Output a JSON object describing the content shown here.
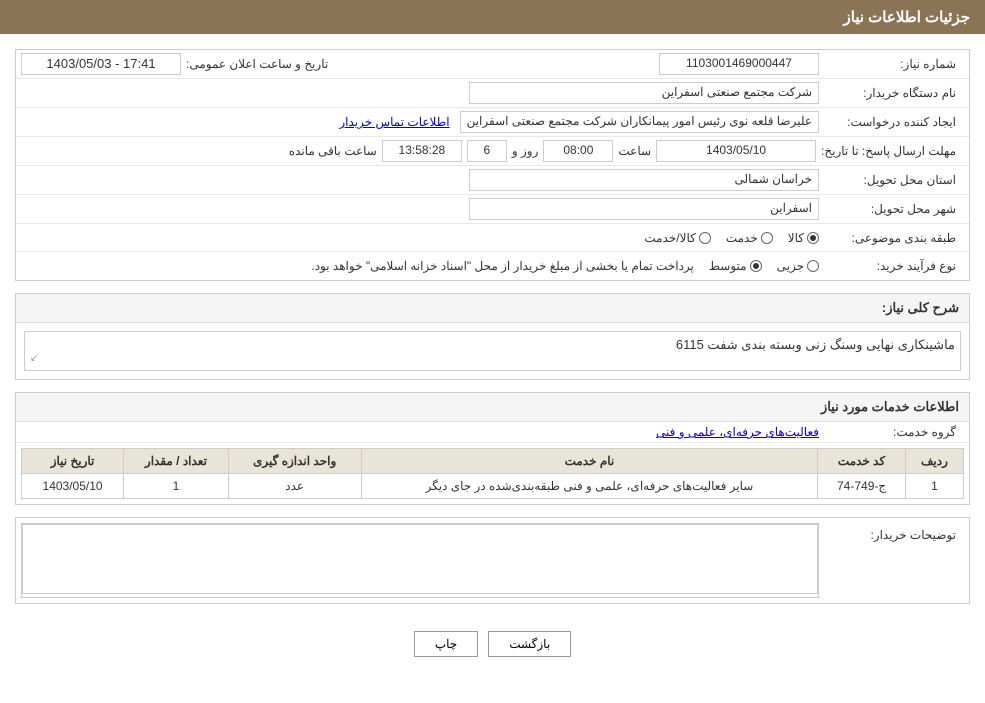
{
  "header": {
    "title": "جزئیات اطلاعات نیاز"
  },
  "fields": {
    "need_number_label": "شماره نیاز:",
    "need_number_value": "1103001469000447",
    "announce_date_label": "تاریخ و ساعت اعلان عمومی:",
    "announce_date_value": "1403/05/03 - 17:41",
    "buyer_name_label": "نام دستگاه خریدار:",
    "buyer_name_value": "شرکت مجتمع صنعتی اسفراین",
    "requester_label": "ایجاد کننده درخواست:",
    "requester_value": "علیرضا قلعه نوی رئیس امور پیمانکاران شرکت مجتمع صنعتی اسفراین",
    "contact_info_link": "اطلاعات تماس خریدار",
    "deadline_label": "مهلت ارسال پاسخ: تا تاریخ:",
    "deadline_date": "1403/05/10",
    "deadline_time_label": "ساعت",
    "deadline_time": "08:00",
    "deadline_day_label": "روز و",
    "deadline_days": "6",
    "deadline_remaining_label": "ساعت باقی مانده",
    "deadline_remaining": "13:58:28",
    "province_label": "استان محل تحویل:",
    "province_value": "خراسان شمالی",
    "city_label": "شهر محل تحویل:",
    "city_value": "اسفراین",
    "category_label": "طبقه بندی موضوعی:",
    "category_options": [
      "کالا",
      "خدمت",
      "کالا/خدمت"
    ],
    "category_selected": "کالا",
    "purchase_type_label": "نوع فرآیند خرید:",
    "purchase_options": [
      "جزیی",
      "متوسط"
    ],
    "purchase_warning": "پرداخت تمام یا بخشی از مبلغ خریدار از محل \"اسناد خزانه اسلامی\" خواهد بود.",
    "need_description_label": "شرح کلی نیاز:",
    "need_description_value": "ماشینکاری نهایی وسنگ زنی وبسته بندی شفت 6115",
    "services_section_title": "اطلاعات خدمات مورد نیاز",
    "service_group_label": "گروه خدمت:",
    "service_group_value": "فعالیت‌های حرفه‌ای، علمی و فنی",
    "table": {
      "headers": [
        "ردیف",
        "کد خدمت",
        "نام خدمت",
        "واحد اندازه گیری",
        "تعداد / مقدار",
        "تاریخ نیاز"
      ],
      "rows": [
        {
          "row": "1",
          "code": "ج-749-74",
          "name": "سایر فعالیت‌های حرفه‌ای، علمی و فنی طبقه‌بندی‌شده در جای دیگر",
          "unit": "عدد",
          "quantity": "1",
          "date": "1403/05/10"
        }
      ]
    },
    "buyer_notes_label": "توضیحات خریدار:",
    "buyer_notes_value": ""
  },
  "buttons": {
    "print_label": "چاپ",
    "back_label": "بازگشت"
  }
}
